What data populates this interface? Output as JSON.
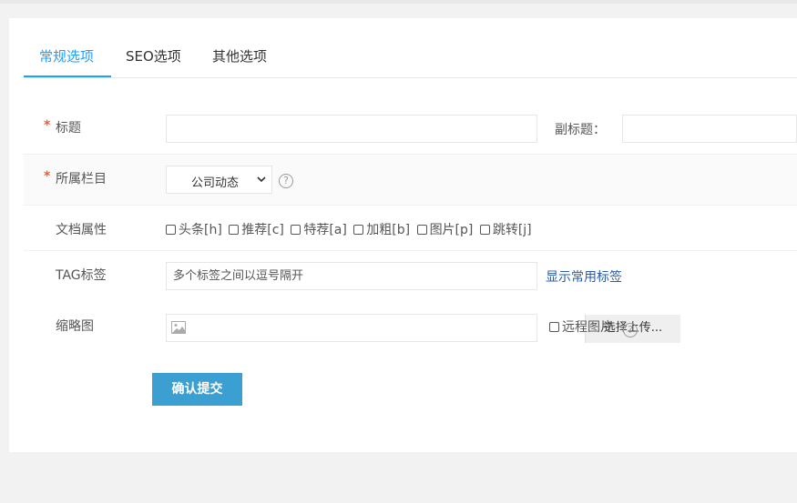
{
  "tabs": [
    {
      "label": "常规选项",
      "active": true
    },
    {
      "label": "SEO选项",
      "active": false
    },
    {
      "label": "其他选项",
      "active": false
    }
  ],
  "form": {
    "title": {
      "required_mark": "*",
      "label": "标题",
      "value": ""
    },
    "subtitle": {
      "label": "副标题：",
      "value": ""
    },
    "category": {
      "required_mark": "*",
      "label": "所属栏目",
      "selected": "公司动态",
      "help": "?"
    },
    "attributes": {
      "label": "文档属性",
      "options": [
        "头条[h]",
        "推荐[c]",
        "特荐[a]",
        "加粗[b]",
        "图片[p]",
        "跳转[j]"
      ]
    },
    "tag": {
      "label": "TAG标签",
      "placeholder": "多个标签之间以逗号隔开",
      "link": "显示常用标签"
    },
    "thumbnail": {
      "label": "缩略图",
      "upload_label": "选择上传...",
      "remote_label": "远程图片",
      "help": "?"
    },
    "submit_label": "确认提交"
  },
  "colors": {
    "accent": "#1e9fff",
    "required": "#ff5722",
    "submit": "#3b9fd2",
    "link": "#2a5caa"
  }
}
